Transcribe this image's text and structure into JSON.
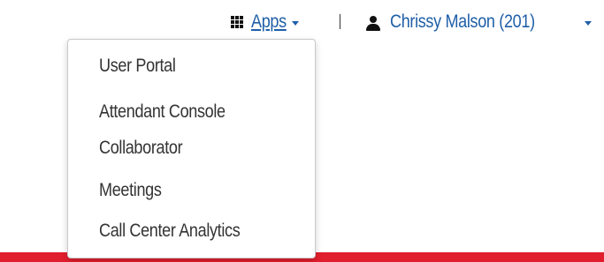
{
  "header": {
    "apps_label": "Apps",
    "user_name": "Chrissy Malson (201)"
  },
  "apps_menu": {
    "items": [
      {
        "label": "User Portal"
      },
      {
        "label": "Attendant Console"
      },
      {
        "label": "Collaborator"
      },
      {
        "label": "Meetings"
      },
      {
        "label": "Call Center Analytics"
      }
    ]
  },
  "colors": {
    "link": "#1f5fa8",
    "menu_text": "#333333",
    "accent_bar": "#e01e2d"
  },
  "icons": {
    "apps": "grid-icon",
    "user": "user-icon",
    "caret": "caret-down-icon"
  }
}
